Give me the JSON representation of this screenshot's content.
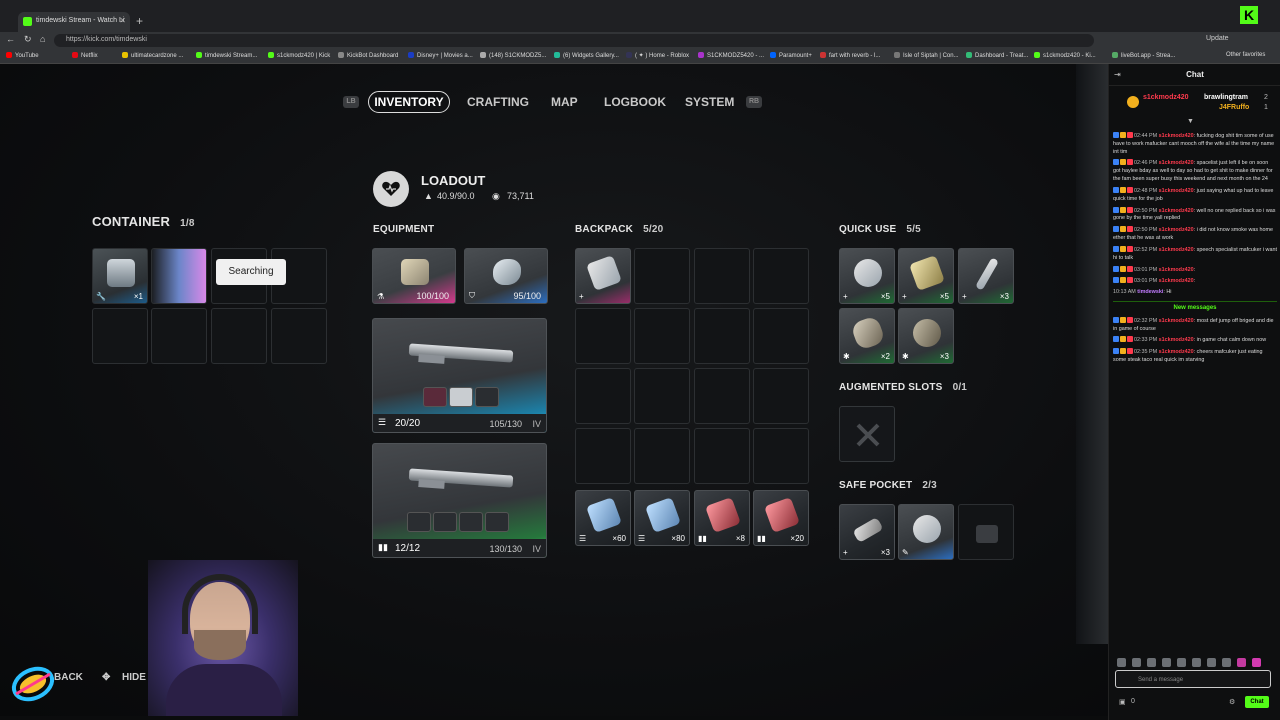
{
  "browser": {
    "tab_title": "timdewski Stream - Watch Li",
    "url": "https://kick.com/timdewski",
    "update_label": "Update",
    "bookmarks": [
      "YouTube",
      "Netflix",
      "ultimatecardzone ...",
      "timdewski Stream...",
      "s1ckmodz420 | Kick",
      "KickBot Dashboard",
      "Disney+ | Movies a...",
      "(148) S1CKMODZ5...",
      "(6) Widgets Gallery...",
      "( ✦ ) Home - Roblox",
      "S1CKMODZ5420 - ...",
      "Paramount+",
      "fart with reverb - l...",
      "Isle of Siptah | Con...",
      "Dashboard - Treat...",
      "s1ckmodz420 - Ki...",
      "liveBot.app - Strea...",
      "Other favorites"
    ]
  },
  "game": {
    "nav": {
      "lb": "LB",
      "rb": "RB",
      "items": [
        "INVENTORY",
        "CRAFTING",
        "MAP",
        "LOGBOOK",
        "SYSTEM"
      ]
    },
    "loadout": {
      "title": "LOADOUT",
      "weight": "40.9/90.0",
      "currency": "73,711"
    },
    "container": {
      "title": "CONTAINER",
      "count": "1/8",
      "item_qty": "×1",
      "tooltip": "Searching"
    },
    "equipment": {
      "title": "EQUIPMENT",
      "augment_value": "100/100",
      "shield_value": "95/100",
      "weapon1_ammo": "20/20",
      "weapon1_durability": "105/130",
      "weapon2_ammo": "12/12",
      "weapon2_durability": "130/130",
      "tier": "IV"
    },
    "backpack": {
      "title": "BACKPACK",
      "count": "5/20",
      "ammo": [
        "×60",
        "×80",
        "×8",
        "×20"
      ]
    },
    "quick_use": {
      "title": "QUICK USE",
      "count": "5/5",
      "qty": [
        "×5",
        "×5",
        "×3",
        "×2",
        "×3"
      ]
    },
    "augmented": {
      "title": "AUGMENTED SLOTS",
      "count": "0/1"
    },
    "safe_pocket": {
      "title": "SAFE POCKET",
      "count": "2/3",
      "qty": "×3"
    },
    "bottom": {
      "back": "BACK",
      "hide": "HIDE T"
    }
  },
  "chat": {
    "title": "Chat",
    "pinned": {
      "user1": "s1ckmodz420",
      "user2": "brawlingtram",
      "user3": "J4FRuffo",
      "n1": "2",
      "n2": "1"
    },
    "messages": [
      {
        "time": "02:44 PM",
        "user": "s1ckmodz420",
        "text": "fucking dog shit tim some of use have to work mafucker cant mooch off the wife al the time my name int tim"
      },
      {
        "time": "02:46 PM",
        "user": "s1ckmodz420",
        "text": "spacelist just left il be on soon got haylee bday as well to day so had to get shit to make dinner for the fam been super busy this weekend and next month on the 24"
      },
      {
        "time": "02:48 PM",
        "user": "s1ckmodz420",
        "text": "just saying what up had to leave quick time for the job"
      },
      {
        "time": "02:50 PM",
        "user": "s1ckmodz420",
        "text": "well no one replied back so i was gone by the time yall replied"
      },
      {
        "time": "02:50 PM",
        "user": "s1ckmodz420",
        "text": "i did not know smoke was home ether that he was at work"
      },
      {
        "time": "02:52 PM",
        "user": "s1ckmodz420",
        "text": "speech specialist mafcuker i want hi to talk"
      },
      {
        "time": "03:01 PM",
        "user": "s1ckmodz420",
        "text": ""
      },
      {
        "time": "03:01 PM",
        "user": "s1ckmodz420",
        "text": ""
      },
      {
        "time": "10:13 AM",
        "user": "timdewski",
        "text": "Hi"
      }
    ],
    "divider": "New messages",
    "new_messages": [
      {
        "time": "02:32 PM",
        "user": "s1ckmodz420",
        "text": "most def jump off briged and die in game of course"
      },
      {
        "time": "02:33 PM",
        "user": "s1ckmodz420",
        "text": "in game chat calm down now"
      },
      {
        "time": "02:35 PM",
        "user": "s1ckmodz420",
        "text": "cheers mafcuker just eating some steak taco real quick im starving"
      }
    ],
    "input_placeholder": "Send a message",
    "send_label": "Chat",
    "points": "0"
  },
  "colors": {
    "kick_green": "#53fc18",
    "username_red": "#ff3a4d"
  }
}
